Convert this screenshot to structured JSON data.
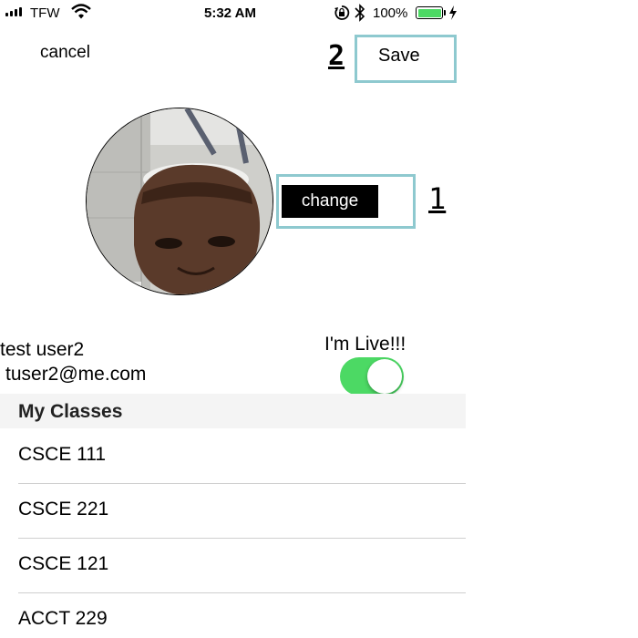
{
  "status_bar": {
    "carrier": "TFW",
    "time": "5:32 AM",
    "battery_percent": "100%",
    "icons": [
      "signal-icon",
      "wifi-icon",
      "rotation-lock-icon",
      "bluetooth-icon",
      "battery-icon",
      "charging-icon"
    ],
    "battery_level": 1.0
  },
  "nav": {
    "cancel_label": "cancel",
    "save_label": "Save",
    "save_marker": "2"
  },
  "profile": {
    "change_label": "change",
    "change_marker": "1",
    "name": "test user2",
    "email": "tuser2@me.com",
    "live_label": "I'm Live!!!",
    "live_toggle_on": true
  },
  "classes": {
    "header": "My Classes",
    "items": [
      "CSCE 111",
      "CSCE 221",
      "CSCE 121",
      "ACCT 229"
    ]
  },
  "colors": {
    "toggle_on": "#4cd964",
    "annotation_box": "#8ec9cf",
    "section_bg": "#f4f4f4"
  }
}
